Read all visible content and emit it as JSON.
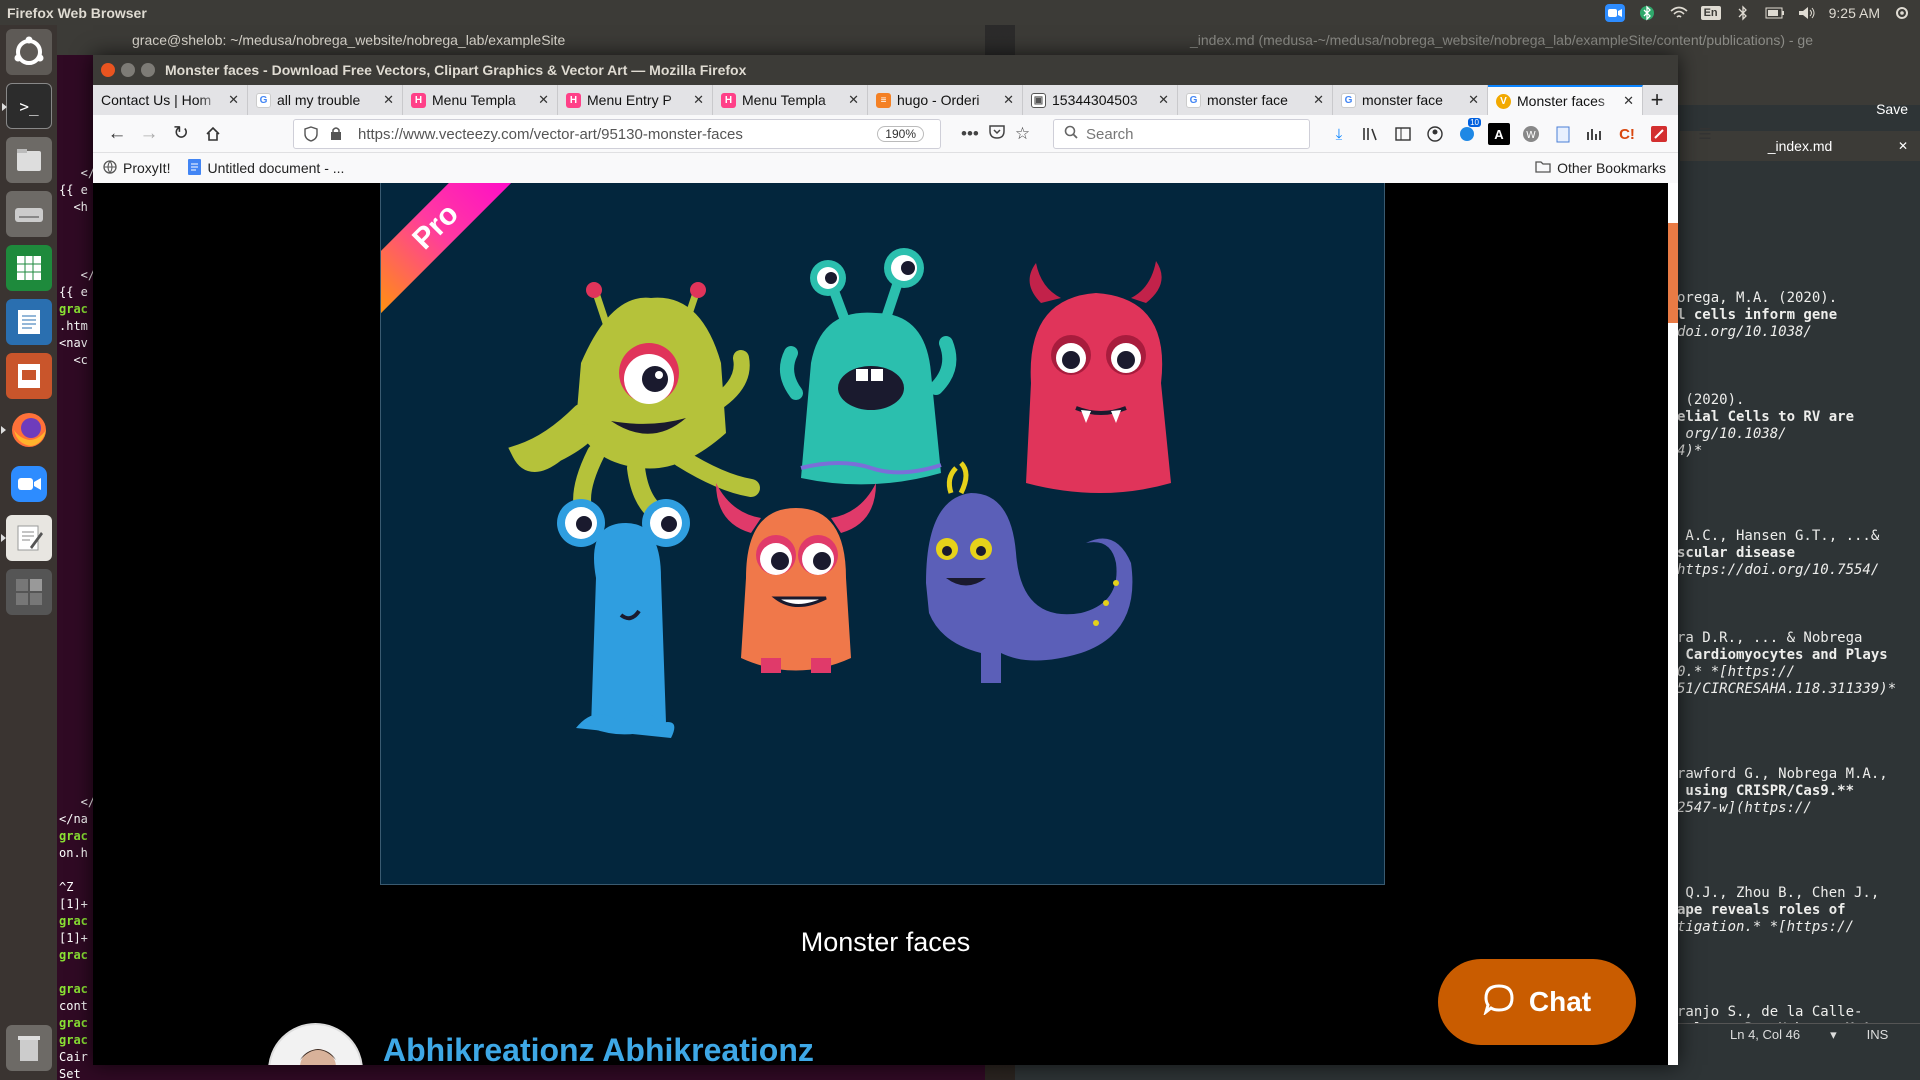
{
  "top_panel": {
    "app_name": "Firefox Web Browser",
    "keyboard": "En",
    "time": "9:25 AM"
  },
  "launcher": {
    "items": [
      "ubuntu-logo-icon",
      "terminal-icon",
      "files-icon",
      "drive-icon",
      "spreadsheet-icon",
      "writer-icon",
      "impress-icon",
      "firefox-icon",
      "zoom-icon",
      "text-editor-icon",
      "workspaces-icon",
      "trash-icon"
    ]
  },
  "bg_terminal": {
    "title": "grace@shelob: ~/medusa/nobrega_website/nobrega_lab/exampleSite"
  },
  "bg_editor": {
    "title": "_index.md (medusa-~/medusa/nobrega_website/nobrega_lab/exampleSite/content/publications) - ge",
    "save": "Save",
    "tab": "_index.md",
    "status_pos": "Ln 4, Col 46",
    "status_mode": "INS"
  },
  "firefox": {
    "window_title": "Monster faces - Download Free Vectors, Clipart Graphics & Vector Art — Mozilla Firefox",
    "tabs": [
      {
        "label": "Contact Us | Hom",
        "icon": "page-icon"
      },
      {
        "label": "all my trouble",
        "icon": "google-icon"
      },
      {
        "label": "Menu Templa",
        "icon": "hugo-icon"
      },
      {
        "label": "Menu Entry P",
        "icon": "hugo-icon"
      },
      {
        "label": "Menu Templa",
        "icon": "hugo-icon"
      },
      {
        "label": "hugo - Orderi",
        "icon": "stackoverflow-icon"
      },
      {
        "label": "15344304503",
        "icon": "image-icon"
      },
      {
        "label": "monster face",
        "icon": "google-icon"
      },
      {
        "label": "monster face",
        "icon": "google-icon"
      },
      {
        "label": "Monster faces",
        "icon": "vecteezy-icon",
        "active": true
      }
    ],
    "url": "https://www.vecteezy.com/vector-art/95130-monster-faces",
    "zoom": "190%",
    "search_placeholder": "Search",
    "toolbar_badge": "10",
    "bookmarks": [
      {
        "label": "ProxyIt!",
        "icon": "globe-icon"
      },
      {
        "label": "Untitled document - ...",
        "icon": "docs-icon"
      }
    ],
    "other_bookmarks": "Other Bookmarks"
  },
  "page": {
    "ribbon": "Pro",
    "caption": "Monster faces",
    "author": "Abhikreationz Abhikreationz",
    "chat": "Chat"
  },
  "colors": {
    "artboard": "#03263d",
    "chat": "#c95c00",
    "author_link": "#3ea8e6"
  }
}
